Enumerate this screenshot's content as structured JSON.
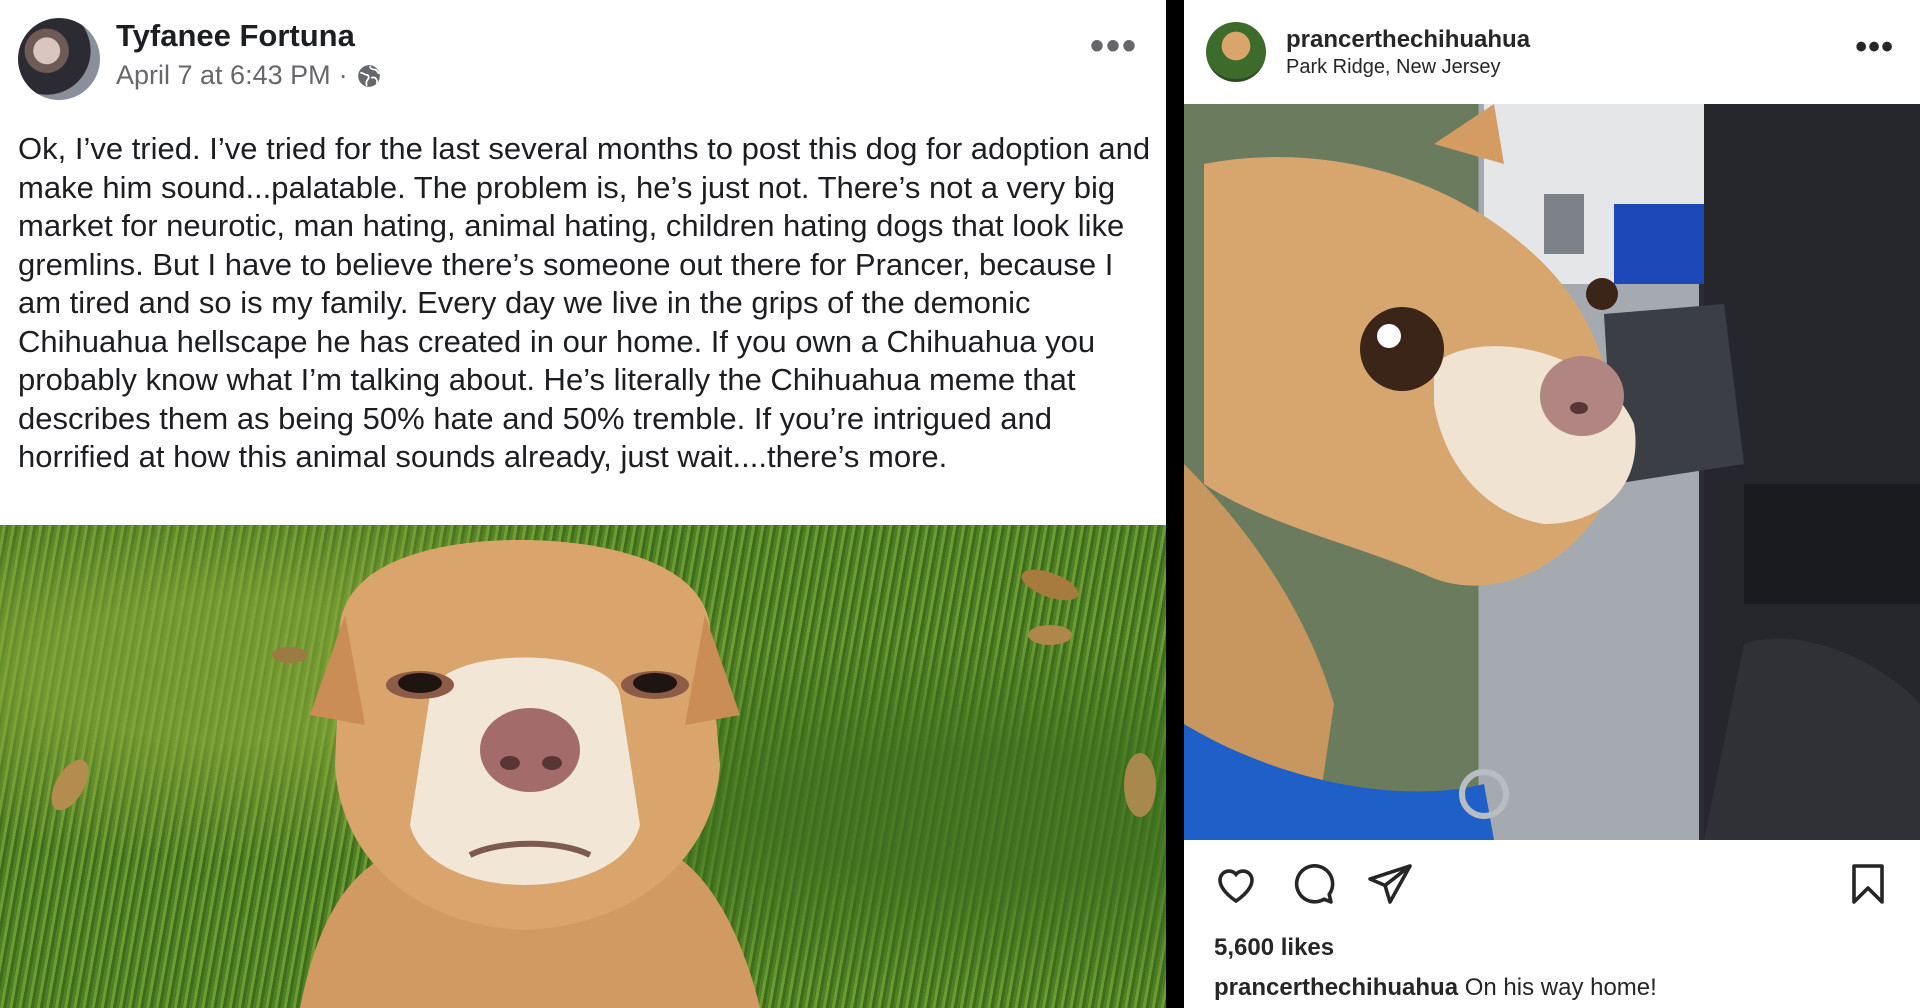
{
  "facebook": {
    "author": "Tyfanee Fortuna",
    "timestamp": "April 7 at 6:43 PM",
    "separator": "·",
    "post_text": "Ok, I’ve tried. I’ve tried for the last several months to post this dog for adoption and make him sound...palatable. The problem is, he’s just not. There’s not a very big market for neurotic, man hating, animal hating, children hating dogs that look like gremlins. But I have to believe there’s someone out there for Prancer, because I am tired and so is my family. Every day we live in the grips of the demonic Chihuahua hellscape he has created in our home. If you own a Chihuahua you probably know what I’m talking about. He’s literally the Chihuahua meme that describes them as being 50% hate and 50% tremble. If you’re intrigued and horrified at how this animal sounds already, just wait....there’s more.",
    "more_label": "•••",
    "icons": {
      "privacy": "globe-icon",
      "more": "more-horizontal-icon"
    }
  },
  "instagram": {
    "username": "prancerthechihuahua",
    "location": "Park Ridge, New Jersey",
    "more_label": "•••",
    "likes": "5,600 likes",
    "caption_user": "prancerthechihuahua",
    "caption_text": " On his way home!",
    "icons": [
      "heart-icon",
      "comment-icon",
      "share-icon",
      "bookmark-icon"
    ]
  },
  "colors": {
    "fb_text": "#1c1e21",
    "fb_meta": "#65676b",
    "ig_text": "#262626",
    "collar": "#1f5fc8",
    "dog_fur": "#d4a06a"
  }
}
